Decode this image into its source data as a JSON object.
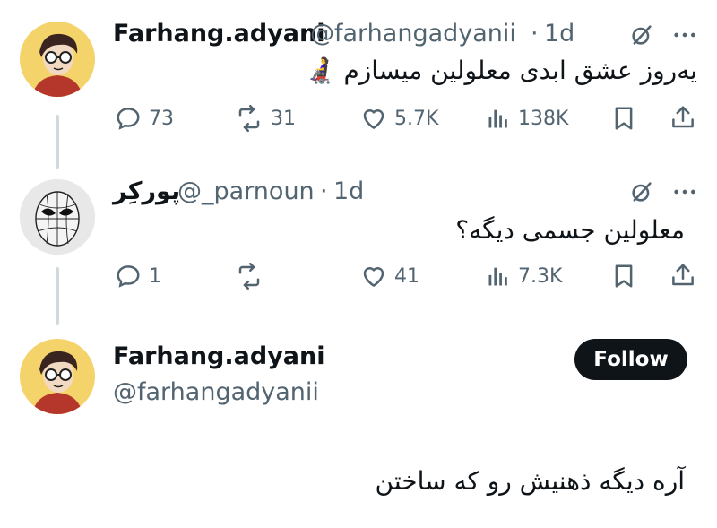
{
  "tweet": {
    "display_name": "Farhang.adyani",
    "handle": "@farhangadyanii",
    "separator": "·",
    "age": "1d",
    "text": "یه‌روز عشق ابدی معلولین میسازم 👩‍🦼",
    "stats": {
      "replies": "73",
      "reposts": "31",
      "likes": "5.7K",
      "views": "138K"
    }
  },
  "reply": {
    "display_name": "پورکِر",
    "handle": "@_parnoun",
    "separator": "·",
    "age": "1d",
    "text": "معلولین جسمی دیگه؟",
    "stats": {
      "replies": "1",
      "reposts": "",
      "likes": "41",
      "views": "7.3K"
    }
  },
  "main_post": {
    "display_name": "Farhang.adyani",
    "handle": "@farhangadyanii",
    "follow_label": "Follow",
    "text": "آره دیگه ذهنیش رو که ساختن"
  },
  "colors": {
    "text": "#0f1419",
    "muted": "#536471",
    "avatar_bg": "#f5d36b",
    "follow_bg": "#0f1419",
    "thread_line": "#cfd9de"
  },
  "icons": [
    "reply-icon",
    "repost-icon",
    "like-icon",
    "views-icon",
    "bookmark-icon",
    "share-icon",
    "grok-icon",
    "more-icon"
  ]
}
